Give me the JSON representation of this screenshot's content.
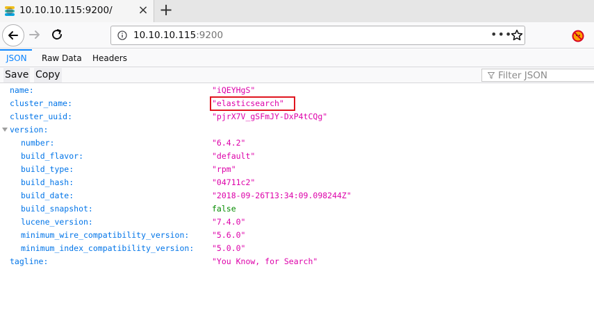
{
  "browser": {
    "tab_title": "10.10.10.115:9200/",
    "tab_close_glyph": "×",
    "new_tab_glyph": "+",
    "url_host": "10.10.10.115",
    "url_port": ":9200",
    "page_actions_glyph": "•••"
  },
  "viewer": {
    "tabs": [
      {
        "label": "JSON",
        "active": true
      },
      {
        "label": "Raw Data",
        "active": false
      },
      {
        "label": "Headers",
        "active": false
      }
    ],
    "save_label": "Save",
    "copy_label": "Copy",
    "filter_placeholder": "Filter JSON"
  },
  "json": {
    "name": {
      "key": "name:",
      "value": "\"iQEYHgS\""
    },
    "cluster_name": {
      "key": "cluster_name:",
      "value": "\"elasticsearch\""
    },
    "cluster_uuid": {
      "key": "cluster_uuid:",
      "value": "\"pjrX7V_gSFmJY-DxP4tCQg\""
    },
    "version": {
      "key": "version:"
    },
    "number": {
      "key": "number:",
      "value": "\"6.4.2\""
    },
    "build_flavor": {
      "key": "build_flavor:",
      "value": "\"default\""
    },
    "build_type": {
      "key": "build_type:",
      "value": "\"rpm\""
    },
    "build_hash": {
      "key": "build_hash:",
      "value": "\"04711c2\""
    },
    "build_date": {
      "key": "build_date:",
      "value": "\"2018-09-26T13:34:09.098244Z\""
    },
    "build_snapshot": {
      "key": "build_snapshot:",
      "value": "false"
    },
    "lucene_version": {
      "key": "lucene_version:",
      "value": "\"7.4.0\""
    },
    "minimum_wire_compatibility_version": {
      "key": "minimum_wire_compatibility_version:",
      "value": "\"5.6.0\""
    },
    "minimum_index_compatibility_version": {
      "key": "minimum_index_compatibility_version:",
      "value": "\"5.0.0\""
    },
    "tagline": {
      "key": "tagline:",
      "value": "\"You Know, for Search\""
    }
  },
  "colors": {
    "key": "#0074e8",
    "string": "#dd00a9",
    "boolean": "#058b00",
    "active_tab": "#0a84ff",
    "highlight": "#e0141e"
  },
  "icons": {
    "favicon": "elasticsearch-logo-icon",
    "back": "arrow-left-icon",
    "forward": "arrow-right-icon",
    "reload": "reload-icon",
    "site_info": "info-icon",
    "bookmark": "star-icon",
    "addon": "blocked-addon-icon",
    "filter": "funnel-icon"
  }
}
